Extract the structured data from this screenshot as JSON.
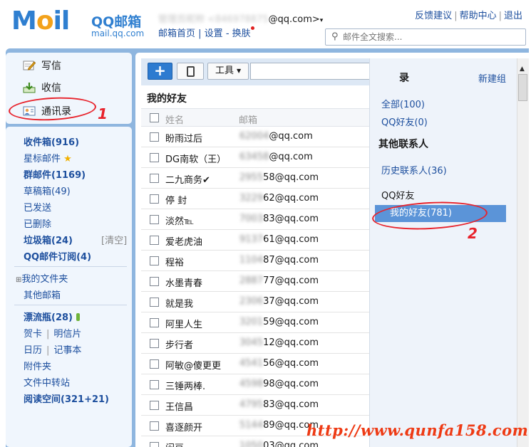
{
  "header": {
    "logo_word": "M",
    "logo_o": "o",
    "logo_tail": "il",
    "logo_brand": "QQ邮箱",
    "logo_domain": "mail.qq.com",
    "account_hidden": "管理员昵称 <846978875",
    "account_suffix": "@qq.com>",
    "links": {
      "home": "邮箱首页",
      "settings": "设置",
      "skin": "换肤"
    },
    "top_links": {
      "feedback": "反馈建议",
      "help": "帮助中心",
      "logout": "退出"
    },
    "search_placeholder": "邮件全文搜索..."
  },
  "sidebar": {
    "actions": {
      "compose": "写信",
      "receive": "收信",
      "contacts": "通讯录"
    },
    "folders": {
      "inbox": "收件箱(916)",
      "starred": "星标邮件",
      "group_mail": "群邮件(1169)",
      "drafts": "草稿箱(49)",
      "sent": "已发送",
      "deleted": "已删除",
      "spam": "垃圾箱(24)",
      "spam_clear": "[清空]",
      "subscriptions": "QQ邮件订阅(4)",
      "my_folders": "我的文件夹",
      "other_mailbox": "其他邮箱",
      "drift": "漂流瓶(28)",
      "greeting_card": "贺卡",
      "postcard": "明信片",
      "calendar": "日历",
      "notebook": "记事本",
      "attachments": "附件夹",
      "file_transfer": "文件中转站",
      "reading": "阅读空间(321+21)"
    }
  },
  "toolbar": {
    "add": "+",
    "tools": "工具",
    "search_icon": "⌕"
  },
  "list": {
    "title": "我的好友",
    "col_name": "姓名",
    "col_email": "邮箱",
    "rows": [
      {
        "name": "盼雨过后",
        "hidden": "62004",
        "suffix": "@qq.com"
      },
      {
        "name": "DG南软（王）",
        "hidden": "63458",
        "suffix": "@qq.com"
      },
      {
        "name": "二九商务✔",
        "hidden": "2955",
        "suffix": "58@qq.com"
      },
      {
        "name": "停 封",
        "hidden": "3229",
        "suffix": "62@qq.com"
      },
      {
        "name": "淡然℡",
        "hidden": "7003",
        "suffix": "83@qq.com"
      },
      {
        "name": "爱老虎油",
        "hidden": "9137",
        "suffix": "61@qq.com"
      },
      {
        "name": "程裕",
        "hidden": "1104",
        "suffix": "87@qq.com"
      },
      {
        "name": "水墨青春",
        "hidden": "2887",
        "suffix": "77@qq.com"
      },
      {
        "name": "就是我",
        "hidden": "2306",
        "suffix": "37@qq.com"
      },
      {
        "name": "阿里人生",
        "hidden": "3201",
        "suffix": "59@qq.com"
      },
      {
        "name": "步行者",
        "hidden": "3045",
        "suffix": "12@qq.com"
      },
      {
        "name": "阿敏@傻更更",
        "hidden": "4541",
        "suffix": "56@qq.com"
      },
      {
        "name": "三锤两棒.",
        "hidden": "4598",
        "suffix": "98@qq.com"
      },
      {
        "name": "王信昌",
        "hidden": "4795",
        "suffix": "83@qq.com"
      },
      {
        "name": "喜逐颜开",
        "hidden": "5144",
        "suffix": "89@qq.com"
      },
      {
        "name": "闷豆",
        "hidden": "1050",
        "suffix": "03@qq.com"
      }
    ]
  },
  "groups": {
    "title_partial": "录",
    "new_group": "新建组",
    "all": "全部(100)",
    "qq_friends_count": "QQ好友(0)",
    "other_contacts": "其他联系人",
    "history": "历史联系人(36)",
    "qq_friends": "QQ好友",
    "my_friends": "我的好友(781)"
  },
  "annotations": {
    "one": "1",
    "two": "2",
    "watermark": "http://www.qunfa158.com"
  }
}
